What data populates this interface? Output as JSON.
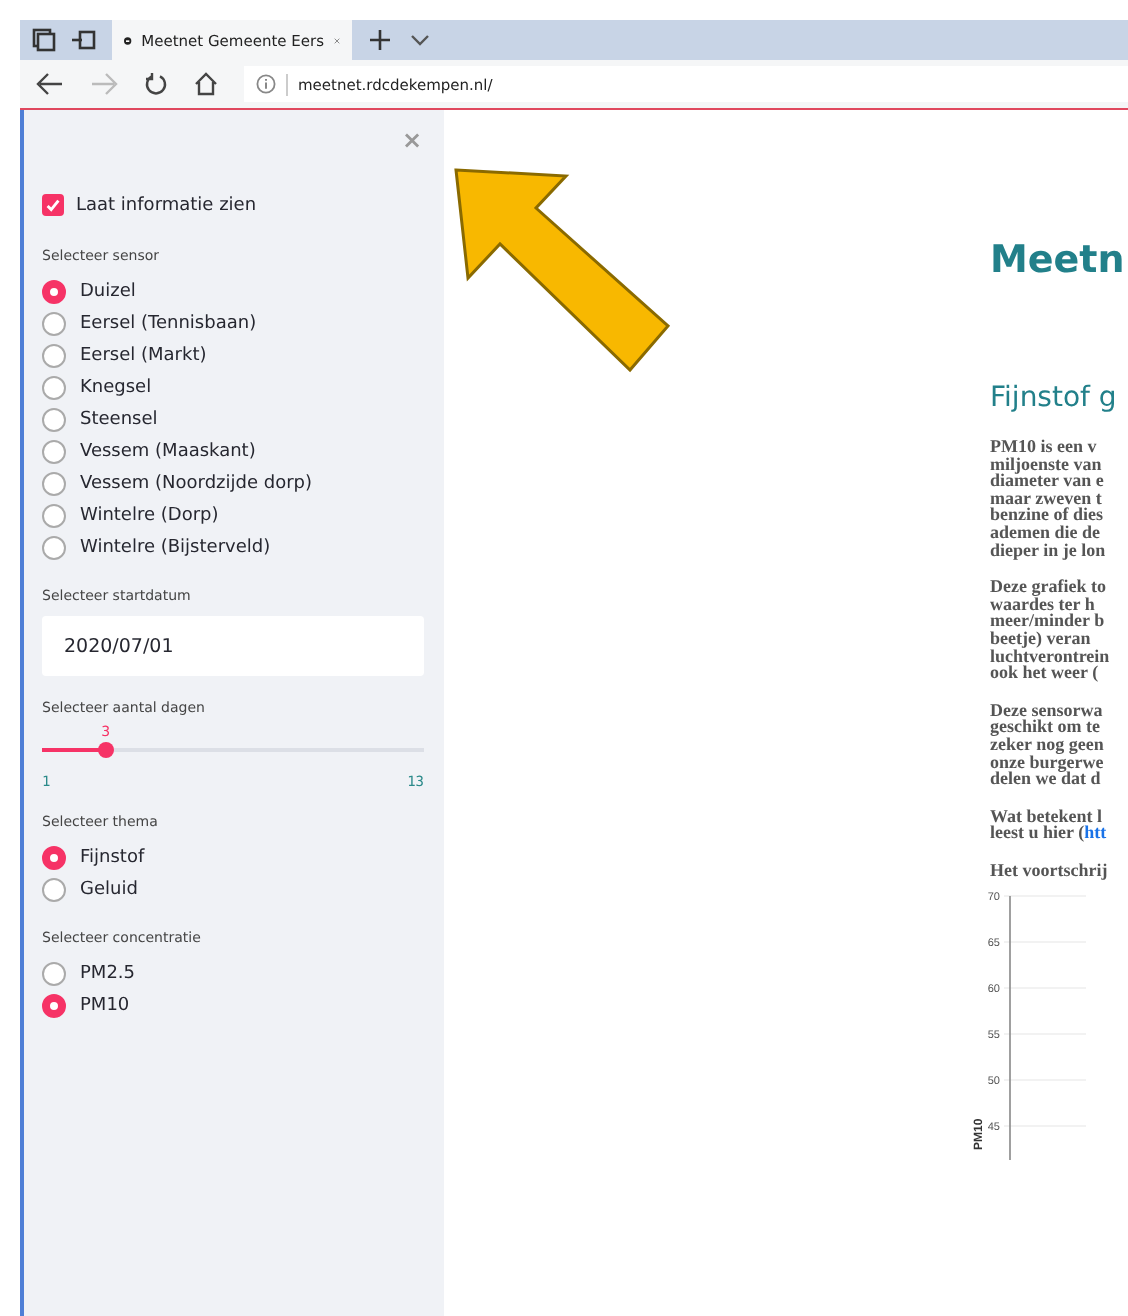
{
  "browser": {
    "tab_title": "Meetnet Gemeente Eers",
    "url": "meetnet.rdcdekempen.nl/",
    "back_disabled": false,
    "forward_disabled": true
  },
  "sidebar": {
    "close": "×",
    "show_info": {
      "label": "Laat informatie zien",
      "checked": true
    },
    "sensor": {
      "label": "Selecteer sensor",
      "options": [
        {
          "label": "Duizel",
          "selected": true
        },
        {
          "label": "Eersel (Tennisbaan)",
          "selected": false
        },
        {
          "label": "Eersel (Markt)",
          "selected": false
        },
        {
          "label": "Knegsel",
          "selected": false
        },
        {
          "label": "Steensel",
          "selected": false
        },
        {
          "label": "Vessem (Maaskant)",
          "selected": false
        },
        {
          "label": "Vessem (Noordzijde dorp)",
          "selected": false
        },
        {
          "label": "Wintelre (Dorp)",
          "selected": false
        },
        {
          "label": "Wintelre (Bijsterveld)",
          "selected": false
        }
      ]
    },
    "startdate": {
      "label": "Selecteer startdatum",
      "value": "2020/07/01"
    },
    "days": {
      "label": "Selecteer aantal dagen",
      "value": "3",
      "min": "1",
      "max": "13",
      "level": 0.167
    },
    "theme": {
      "label": "Selecteer thema",
      "options": [
        {
          "label": "Fijnstof",
          "selected": true
        },
        {
          "label": "Geluid",
          "selected": false
        }
      ]
    },
    "concentration": {
      "label": "Selecteer concentratie",
      "options": [
        {
          "label": "PM2.5",
          "selected": false
        },
        {
          "label": "PM10",
          "selected": true
        }
      ]
    }
  },
  "main": {
    "title": "Meetn",
    "subtitle": "Fijnstof g",
    "paragraphs": [
      [
        {
          "text": "PM10 is een v"
        },
        {
          "text": "miljoenste van"
        },
        {
          "text": "diameter van e"
        },
        {
          "text": "maar zweven t"
        },
        {
          "text": "benzine of dies"
        },
        {
          "text": "ademen die de"
        },
        {
          "text": "dieper in je lon"
        }
      ],
      [
        {
          "text": "Deze grafiek to"
        },
        {
          "text": "waardes ter h"
        },
        {
          "text": "meer/minder b"
        },
        {
          "text": "beetje) veran"
        },
        {
          "text": "luchtverontrein"
        },
        {
          "text": "ook het weer ("
        }
      ],
      [
        {
          "text": "Deze sensorwa"
        },
        {
          "text": "geschikt om te"
        },
        {
          "text": "zeker nog geen"
        },
        {
          "text": "onze burgerwe"
        },
        {
          "text": "delen we dat d"
        }
      ],
      [
        {
          "text": "Wat betekent l"
        },
        {
          "text": "leest u hier (",
          "link": "htt"
        }
      ]
    ],
    "chart_heading": "Het voortschrij",
    "chart": {
      "ylabel": "PM10",
      "yticks": [
        "70",
        "65",
        "60",
        "55",
        "50",
        "45"
      ]
    }
  }
}
